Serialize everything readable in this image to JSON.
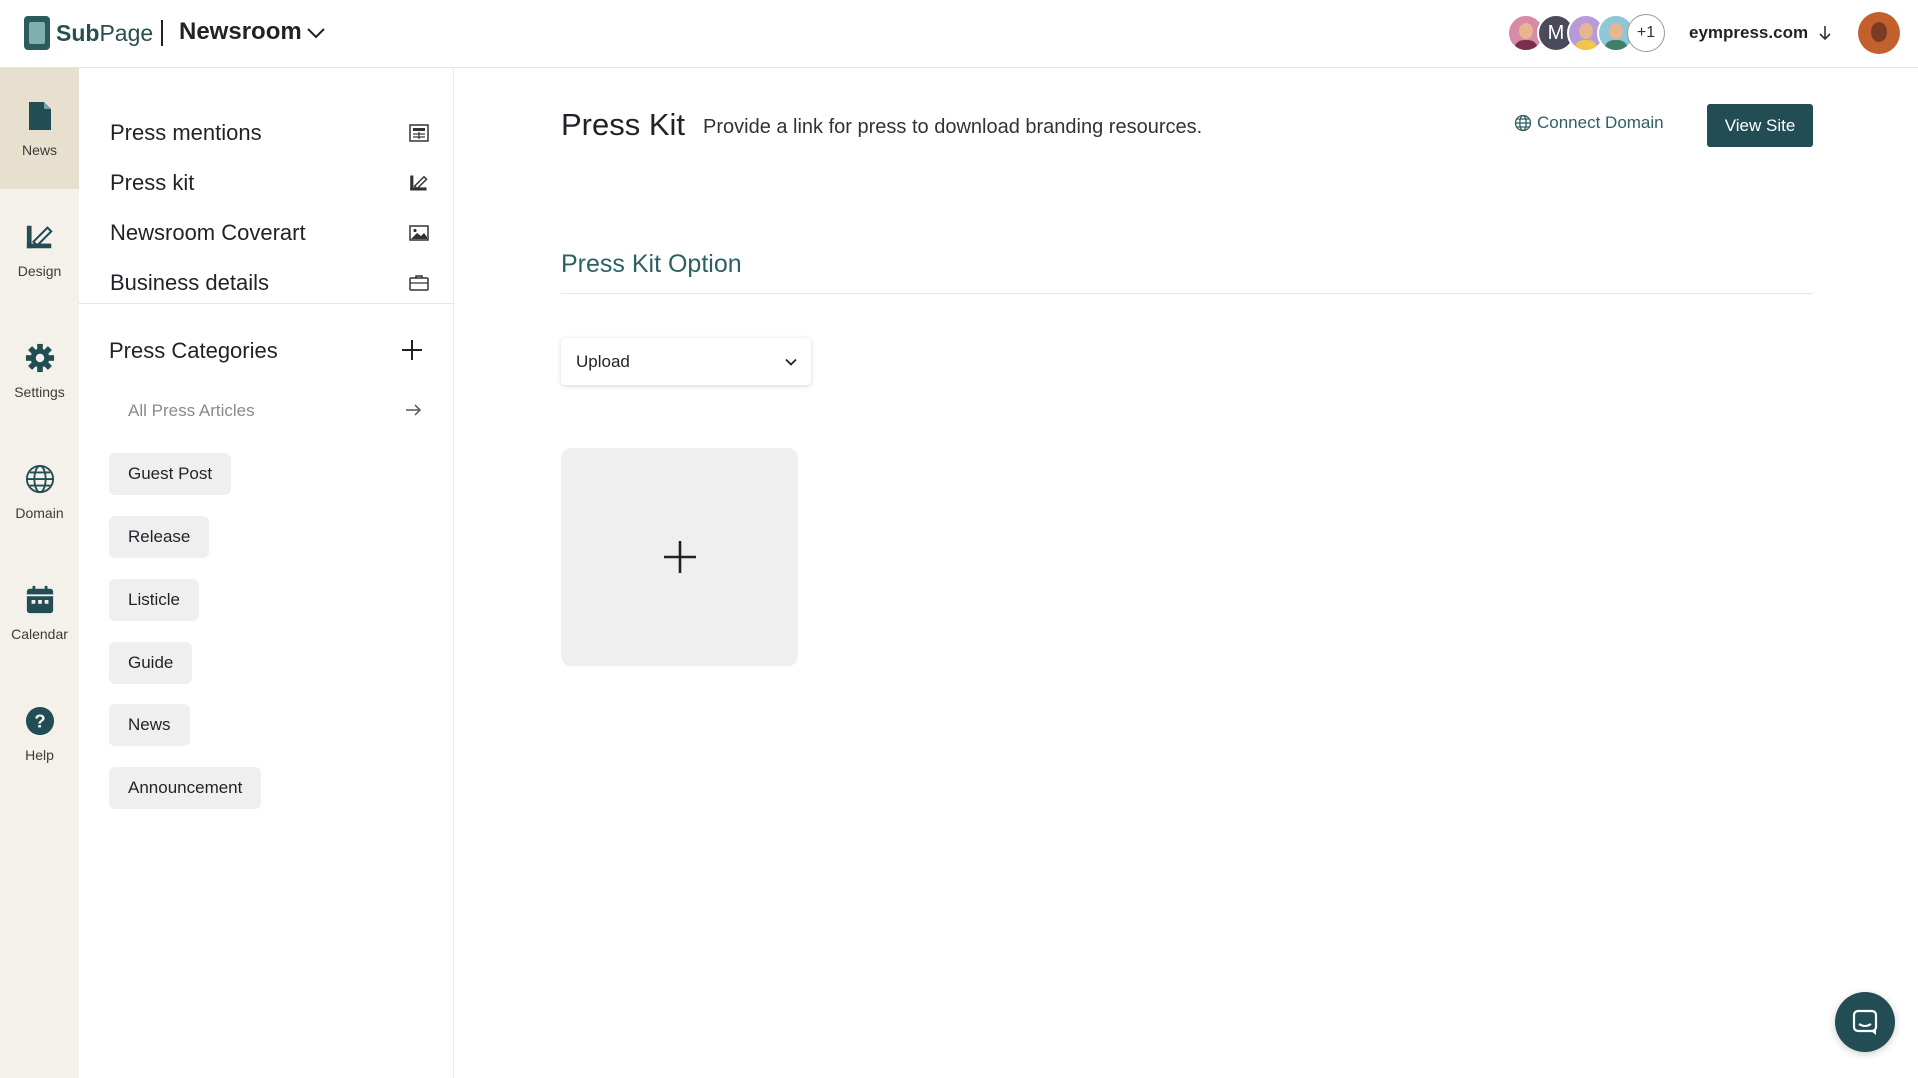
{
  "header": {
    "brand_bold": "Sub",
    "brand_light": "Page",
    "workspace": "Newsroom",
    "avatar_letter": "M",
    "avatar_more": "+1",
    "site_domain": "eympress.com"
  },
  "rail": {
    "items": [
      {
        "label": "News",
        "icon": "document-icon",
        "active": true
      },
      {
        "label": "Design",
        "icon": "design-icon"
      },
      {
        "label": "Settings",
        "icon": "gear-icon"
      },
      {
        "label": "Domain",
        "icon": "globe-icon"
      },
      {
        "label": "Calendar",
        "icon": "calendar-icon"
      },
      {
        "label": "Help",
        "icon": "help-icon"
      }
    ]
  },
  "panel": {
    "nav": [
      {
        "label": "Press mentions",
        "icon": "newspaper-icon"
      },
      {
        "label": "Press kit",
        "icon": "design-icon"
      },
      {
        "label": "Newsroom Coverart",
        "icon": "image-icon"
      },
      {
        "label": "Business details",
        "icon": "briefcase-icon"
      }
    ],
    "categories_title": "Press Categories",
    "all_articles": "All Press Articles",
    "categories": [
      "Guest Post",
      "Release",
      "Listicle",
      "Guide",
      "News",
      "Announcement"
    ]
  },
  "main": {
    "title": "Press Kit",
    "description": "Provide a link for press to download branding resources.",
    "connect_domain": "Connect Domain",
    "view_site": "View Site",
    "section_title": "Press Kit Option",
    "option_selected": "Upload"
  },
  "colors": {
    "brand": "#234d55",
    "rail_bg": "#f4f1ea",
    "rail_active": "#e8e0cf",
    "accent_text": "#2e5f63"
  }
}
